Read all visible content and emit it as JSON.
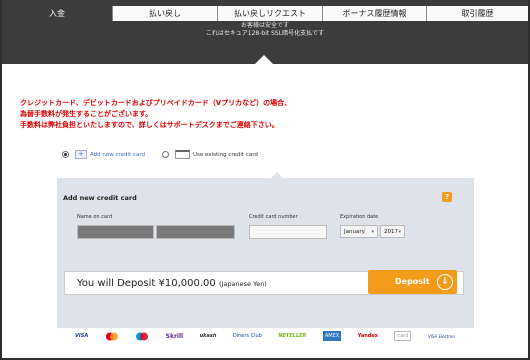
{
  "tabs": [
    {
      "label": "入金",
      "active": true
    },
    {
      "label": "払い戻し",
      "active": false
    },
    {
      "label": "払い戻しリクエスト",
      "active": false
    },
    {
      "label": "ボーナス履歴情報",
      "active": false
    },
    {
      "label": "取引履歴",
      "active": false
    }
  ],
  "secure_text": {
    "line1": "お客様は安全です",
    "line2": "これはセキュア128-bit SSL暗号化支払です"
  },
  "notice": {
    "line1": "クレジットカード、デビットカードおよびプリペイドカード（Vプリカなど）の場合、",
    "line2": "為替手数料が発生することがございます。",
    "line3": "手数料は弊社負担といたしますので、詳しくはサポートデスクまでご連絡下さい。"
  },
  "card_choice": {
    "add_new": "Add new credit card",
    "use_existing": "Use existing credit card",
    "selected": "add_new"
  },
  "form": {
    "title": "Add new credit card",
    "name_label": "Name on card",
    "number_label": "Credit card number",
    "expiry_label": "Expiration date",
    "month_value": "January",
    "year_value": "2017"
  },
  "deposit": {
    "prefix": "You will Deposit ",
    "amount": "¥10,000.00",
    "currency": "(Japanese Yen)",
    "button_label": "Deposit"
  },
  "payment_logos": [
    "VISA",
    "MasterCard",
    "Maestro",
    "Skrill",
    "ukash",
    "Diners Club",
    "NETELLER",
    "AMEX",
    "Yandex",
    "card",
    "VISA Electron"
  ],
  "colors": {
    "header_bg": "#3c3c3c",
    "notice_text": "#e00000",
    "panel_bg": "#dde3e8",
    "accent": "#f39c1c"
  }
}
